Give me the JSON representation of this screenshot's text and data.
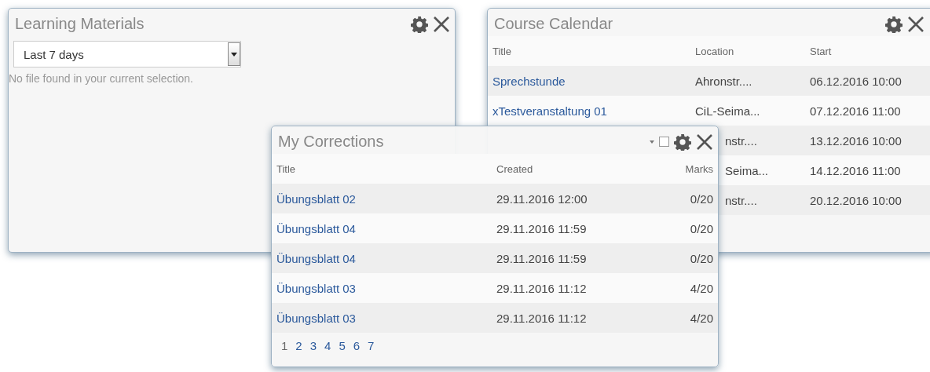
{
  "learning_materials": {
    "title": "Learning Materials",
    "period_select": {
      "value": "Last 7 days"
    },
    "message": "No file found in your current selection."
  },
  "course_calendar": {
    "title": "Course Calendar",
    "columns": [
      "Title",
      "Location",
      "Start"
    ],
    "rows": [
      {
        "title": "Sprechstunde",
        "location": "Ahronstr....",
        "start": "06.12.2016 10:00"
      },
      {
        "title": "xTestveranstaltung 01",
        "location": "CiL-Seima...",
        "start": "07.12.2016 11:00"
      },
      {
        "location": "nstr....",
        "start": "13.12.2016 10:00"
      },
      {
        "location": "Seima...",
        "start": "14.12.2016 11:00"
      },
      {
        "location": "nstr....",
        "start": "20.12.2016 10:00"
      }
    ]
  },
  "my_corrections": {
    "title": "My Corrections",
    "columns": [
      "Title",
      "Created",
      "Marks"
    ],
    "rows": [
      {
        "title": "Übungsblatt 02",
        "created": "29.11.2016 12:00",
        "marks": "0/20"
      },
      {
        "title": "Übungsblatt 04",
        "created": "29.11.2016 11:59",
        "marks": "0/20"
      },
      {
        "title": "Übungsblatt 04",
        "created": "29.11.2016 11:59",
        "marks": "0/20"
      },
      {
        "title": "Übungsblatt 03",
        "created": "29.11.2016 11:12",
        "marks": "4/20"
      },
      {
        "title": "Übungsblatt 03",
        "created": "29.11.2016 11:12",
        "marks": "4/20"
      }
    ],
    "pages": [
      {
        "label": "1",
        "selected": true
      },
      {
        "label": "2",
        "selected": false
      },
      {
        "label": "3",
        "selected": false
      },
      {
        "label": "4",
        "selected": false
      },
      {
        "label": "5",
        "selected": false
      },
      {
        "label": "6",
        "selected": false
      },
      {
        "label": "7",
        "selected": false
      }
    ]
  }
}
